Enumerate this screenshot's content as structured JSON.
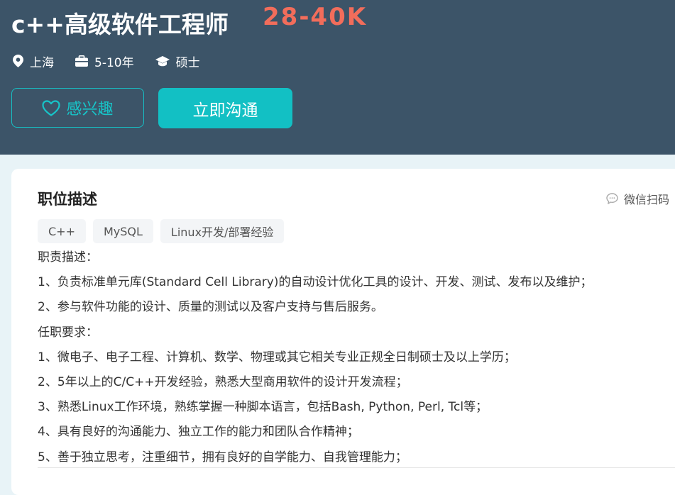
{
  "job": {
    "title": "c++高级软件工程师",
    "salary": "28-40K",
    "location": "上海",
    "experience": "5-10年",
    "degree": "硕士"
  },
  "actions": {
    "interest_label": "感兴趣",
    "chat_label": "立即沟通"
  },
  "section": {
    "title": "职位描述",
    "wechat_label": "微信扫码"
  },
  "tags": [
    "C++",
    "MySQL",
    "Linux开发/部署经验"
  ],
  "description": [
    "职责描述：",
    "1、负责标准单元库(Standard Cell Library)的自动设计优化工具的设计、开发、测试、发布以及维护；",
    "2、参与软件功能的设计、质量的测试以及客户支持与售后服务。",
    "任职要求：",
    "1、微电子、电子工程、计算机、数学、物理或其它相关专业正规全日制硕士及以上学历；",
    "2、5年以上的C/C++开发经验，熟悉大型商用软件的设计开发流程；",
    "3、熟悉Linux工作环境，熟练掌握一种脚本语言，包括Bash, Python, Perl, Tcl等；",
    "4、具有良好的沟通能力、独立工作的能力和团队合作精神；",
    "5、善于独立思考，注重细节，拥有良好的自学能力、自我管理能力；"
  ],
  "icons": {
    "location": "location-pin-icon",
    "experience": "briefcase-icon",
    "degree": "graduation-cap-icon",
    "interest": "heart-icon",
    "wechat": "chat-bubble-icon"
  },
  "colors": {
    "header_bg": "#3c5468",
    "salary": "#f26d5b",
    "accent": "#12c0c4"
  }
}
